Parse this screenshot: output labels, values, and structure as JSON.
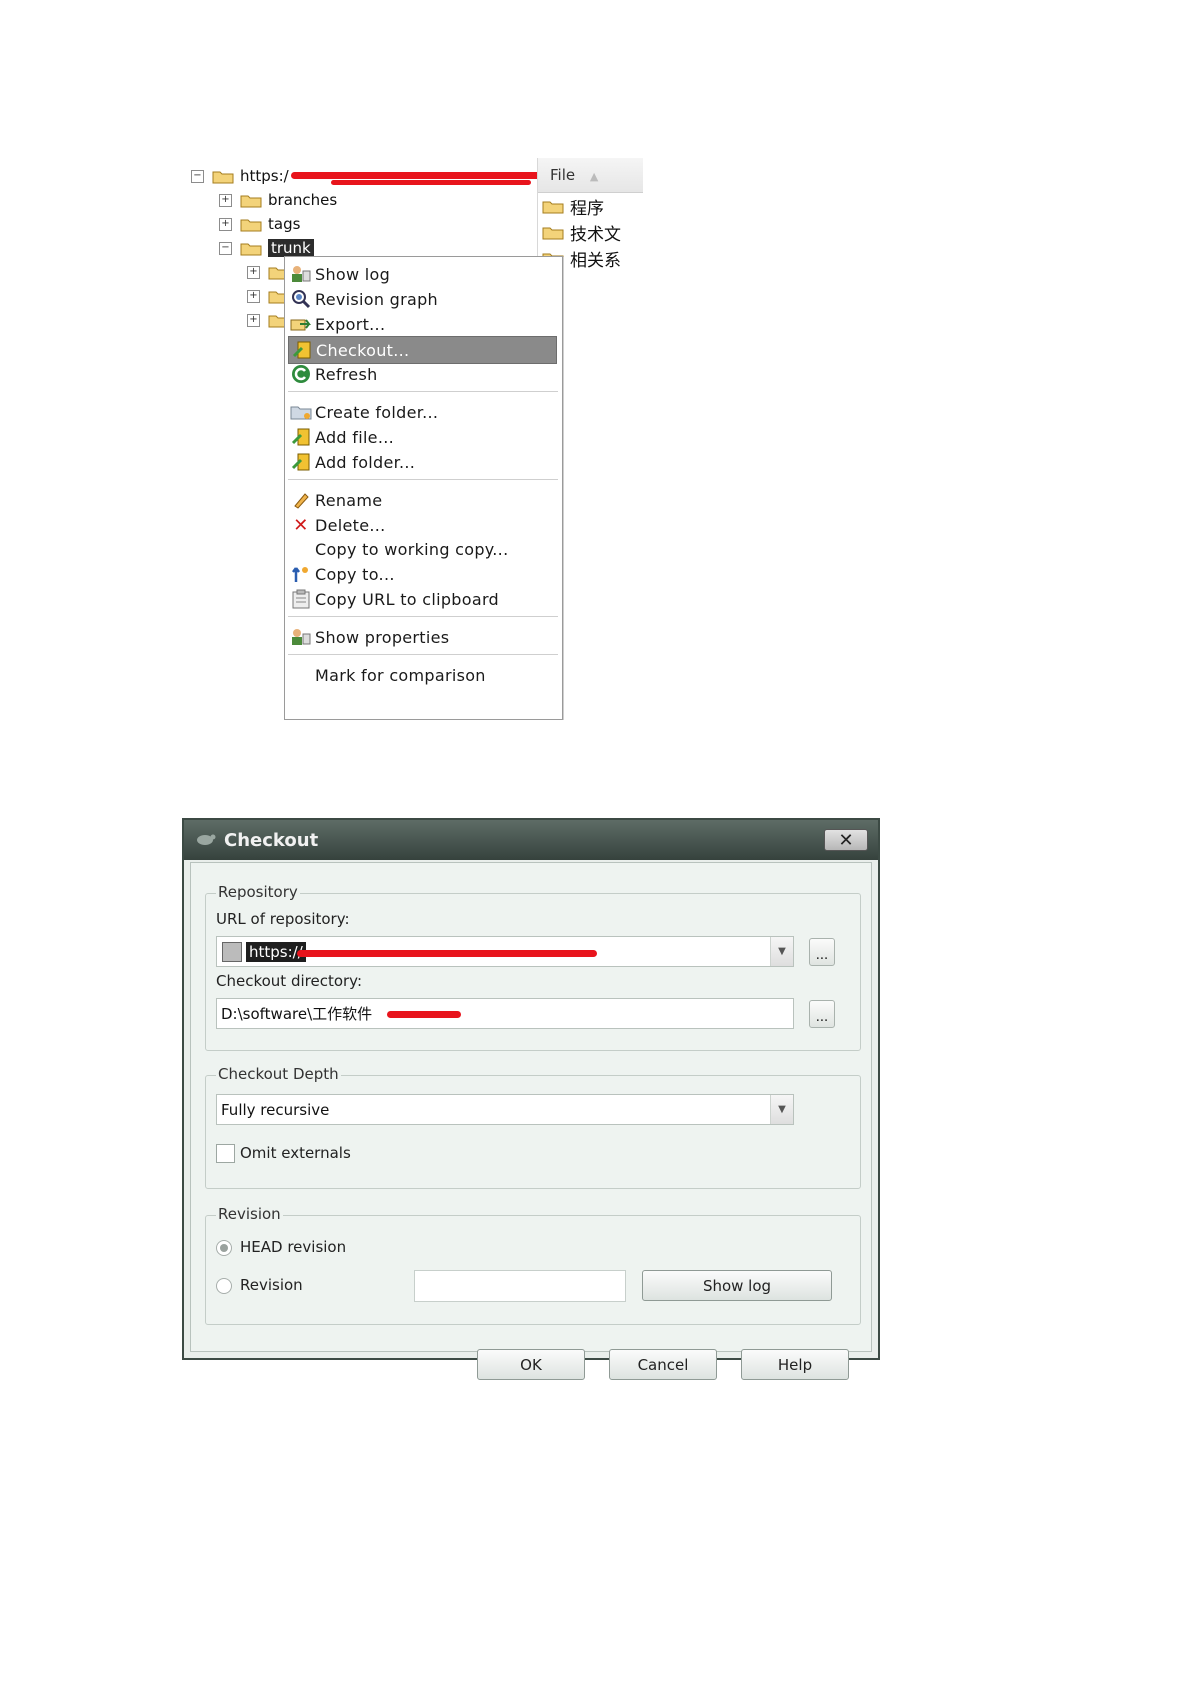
{
  "repo_browser": {
    "root_url": "https:/",
    "items": [
      {
        "label": "branches"
      },
      {
        "label": "tags"
      },
      {
        "label": "trunk"
      }
    ],
    "file_pane": {
      "header": "File",
      "rows": [
        "程序",
        "技术文",
        "相关系"
      ]
    }
  },
  "context_menu": {
    "items": [
      {
        "label": "Show log",
        "icon": "show-log-icon"
      },
      {
        "label": "Revision graph",
        "icon": "revision-graph-icon"
      },
      {
        "label": "Export...",
        "icon": "export-icon"
      },
      {
        "label": "Checkout...",
        "icon": "checkout-icon"
      },
      {
        "label": "Refresh",
        "icon": "refresh-icon"
      },
      {
        "label": "Create folder...",
        "icon": "create-folder-icon"
      },
      {
        "label": "Add file...",
        "icon": "add-file-icon"
      },
      {
        "label": "Add folder...",
        "icon": "add-folder-icon"
      },
      {
        "label": "Rename",
        "icon": "rename-icon"
      },
      {
        "label": "Delete...",
        "icon": "delete-icon"
      },
      {
        "label": "Copy to working copy...",
        "icon": ""
      },
      {
        "label": "Copy to...",
        "icon": "copy-to-icon"
      },
      {
        "label": "Copy URL to clipboard",
        "icon": "clipboard-icon"
      },
      {
        "label": "Show properties",
        "icon": "show-properties-icon"
      },
      {
        "label": "Mark for comparison",
        "icon": ""
      }
    ]
  },
  "checkout_dialog": {
    "title": "Checkout",
    "repository_group": "Repository",
    "url_label": "URL of repository:",
    "url_value": "https://",
    "checkout_dir_label": "Checkout directory:",
    "checkout_dir_value": "D:\\software\\工作软件",
    "browse_label": "...",
    "depth_group": "Checkout Depth",
    "depth_value": "Fully recursive",
    "omit_externals_label": "Omit externals",
    "revision_group": "Revision",
    "head_revision_label": "HEAD revision",
    "revision_label": "Revision",
    "show_log_label": "Show log",
    "ok_label": "OK",
    "cancel_label": "Cancel",
    "help_label": "Help"
  }
}
